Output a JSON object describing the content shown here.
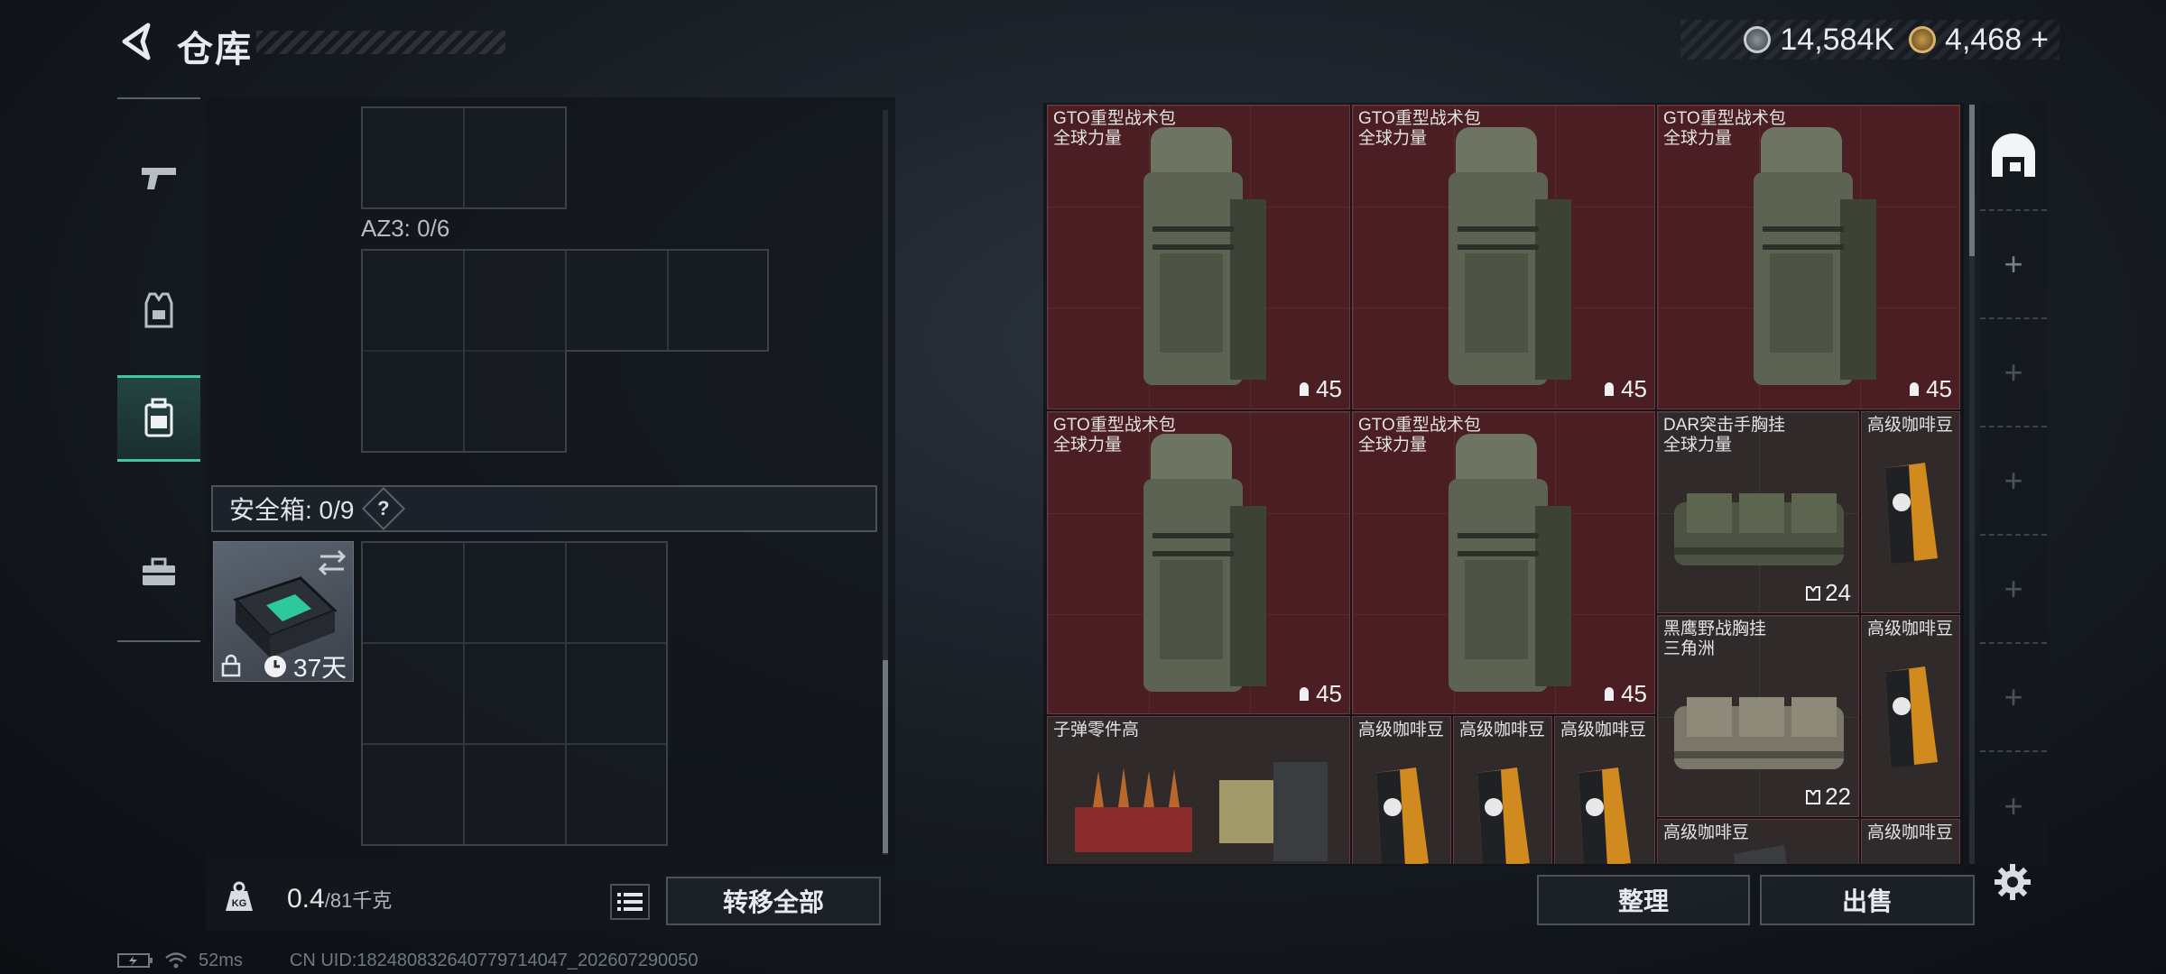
{
  "header": {
    "title": "仓库",
    "currency": [
      {
        "icon": "silver-coin-icon",
        "value": "14,584K"
      },
      {
        "icon": "gold-coin-icon",
        "value": "4,468",
        "add": "+"
      }
    ]
  },
  "tabs": [
    {
      "icon": "pistol-icon"
    },
    {
      "icon": "armor-vest-icon"
    },
    {
      "icon": "backpack-icon",
      "active": true
    },
    {
      "icon": "toolbox-icon"
    }
  ],
  "left": {
    "az3_label": "AZ3: 0/6",
    "safebox_label": "安全箱: 0/9",
    "help": "?",
    "case_timer": "37天",
    "weight_value": "0.4",
    "weight_max": "/81千克",
    "transfer_all": "转移全部"
  },
  "status": {
    "ping": "52ms",
    "uid": "CN UID:1824808326407797140​47_202607290050"
  },
  "items": [
    {
      "name": "GTO重型战术包",
      "sub": "全球力量",
      "count": "45",
      "kind": "backpack"
    },
    {
      "name": "GTO重型战术包",
      "sub": "全球力量",
      "count": "45",
      "kind": "backpack"
    },
    {
      "name": "GTO重型战术包",
      "sub": "全球力量",
      "count": "45",
      "kind": "backpack"
    },
    {
      "name": "GTO重型战术包",
      "sub": "全球力量",
      "count": "45",
      "kind": "backpack"
    },
    {
      "name": "GTO重型战术包",
      "sub": "全球力量",
      "count": "45",
      "kind": "backpack"
    },
    {
      "name": "DAR突击手胸挂",
      "sub": "全球力量",
      "count": "24",
      "kind": "rig"
    },
    {
      "name": "高级咖啡豆",
      "kind": "coffee"
    },
    {
      "name": "黑鹰野战胸挂",
      "sub": "三角洲",
      "count": "22",
      "kind": "rig2"
    },
    {
      "name": "高级咖啡豆",
      "kind": "coffee"
    },
    {
      "name": "子弹零件高",
      "kind": "ammo"
    },
    {
      "name": "高级咖啡豆",
      "kind": "coffee"
    },
    {
      "name": "高级咖啡豆",
      "kind": "coffee"
    },
    {
      "name": "高级咖啡豆",
      "kind": "coffee"
    },
    {
      "name": "高级咖啡豆",
      "kind": "coffee"
    },
    {
      "name": "高级咖啡豆",
      "kind": "coffee"
    }
  ],
  "actions": {
    "sort": "整理",
    "sell": "出售"
  }
}
